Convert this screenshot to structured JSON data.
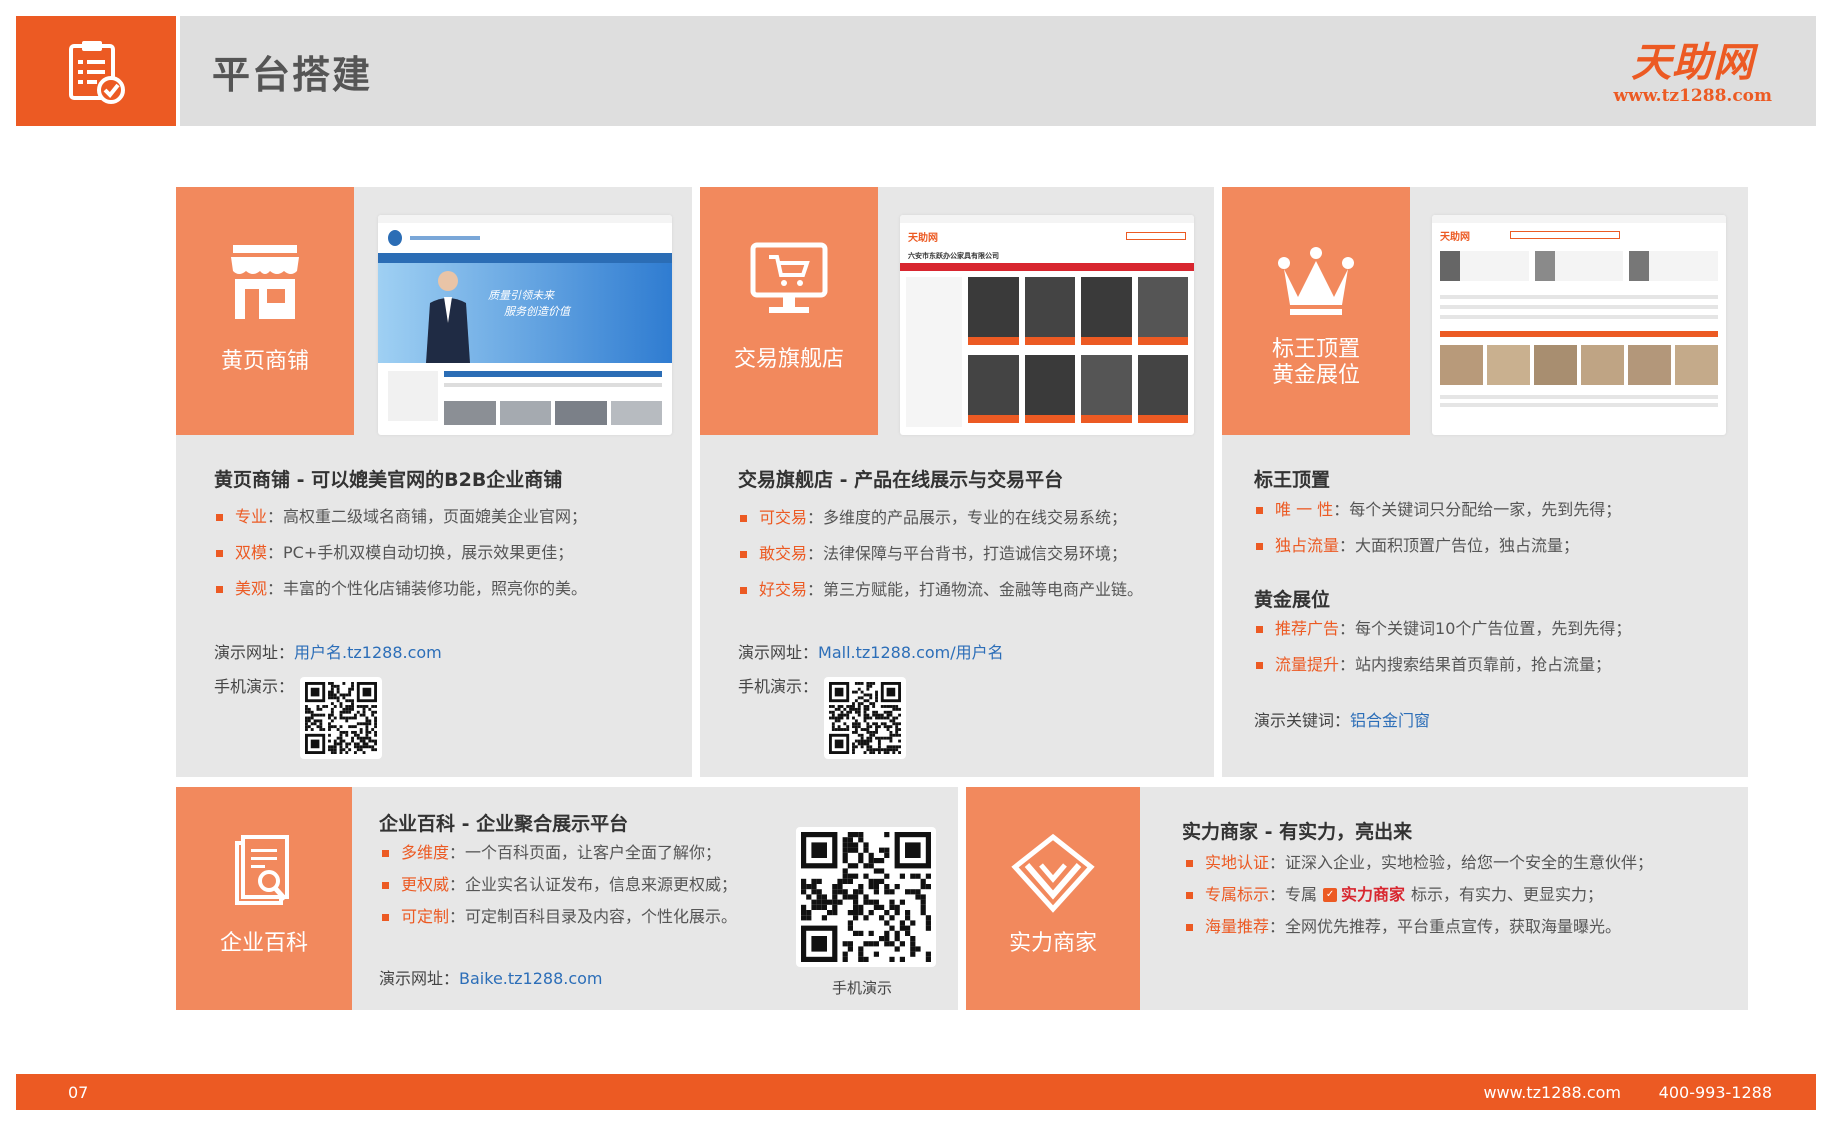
{
  "header": {
    "title": "平台搭建",
    "logo_text": "天助网",
    "logo_url": "www.tz1288.com",
    "accent": "#ec5a23"
  },
  "yellow_pages": {
    "tile_label": "黄页商铺",
    "title": "黄页商铺 - 可以媲美官网的B2B企业商铺",
    "items": [
      {
        "key": "专业",
        "text": "：高权重二级域名商铺，页面媲美企业官网；"
      },
      {
        "key": "双模",
        "text": "：PC+手机双模自动切换，展示效果更佳；"
      },
      {
        "key": "美观",
        "text": "：丰富的个性化店铺装修功能，照亮你的美。"
      }
    ],
    "demo_label": "演示网址：",
    "demo_link": "用户名.tz1288.com",
    "mobile_label": "手机演示：",
    "shot_banner_line1": "质量引领未来",
    "shot_banner_line2": "服务创造价值"
  },
  "flagship": {
    "tile_label": "交易旗舰店",
    "title": "交易旗舰店 - 产品在线展示与交易平台",
    "items": [
      {
        "key": "可交易",
        "text": "：多维度的产品展示，专业的在线交易系统；"
      },
      {
        "key": "敢交易",
        "text": "：法律保障与平台背书，打造诚信交易环境；"
      },
      {
        "key": "好交易",
        "text": "：第三方赋能，打通物流、金融等电商产业链。"
      }
    ],
    "demo_label": "演示网址：",
    "demo_link": "Mall.tz1288.com/用户名",
    "mobile_label": "手机演示：",
    "shot_company": "六安市东跃办公家具有限公司",
    "shot_logo": "天助网"
  },
  "top_ads": {
    "tile_label_1": "标王顶置",
    "tile_label_2": "黄金展位",
    "section1_title": "标王顶置",
    "section1_items": [
      {
        "key": "唯 一 性",
        "text": "：每个关键词只分配给一家，先到先得；"
      },
      {
        "key": "独占流量",
        "text": "：大面积顶置广告位，独占流量；"
      }
    ],
    "section2_title": "黄金展位",
    "section2_items": [
      {
        "key": "推荐广告",
        "text": "：每个关键词10个广告位置，先到先得；"
      },
      {
        "key": "流量提升",
        "text": "：站内搜索结果首页靠前，抢占流量；"
      }
    ],
    "demo_label": "演示关键词：",
    "demo_link": "铝合金门窗",
    "shot_logo": "天助网"
  },
  "baike": {
    "tile_label": "企业百科",
    "title": "企业百科 - 企业聚合展示平台",
    "items": [
      {
        "key": "多维度",
        "text": "：一个百科页面，让客户全面了解你；"
      },
      {
        "key": "更权威",
        "text": "：企业实名认证发布，信息来源更权威；"
      },
      {
        "key": "可定制",
        "text": "：可定制百科目录及内容，个性化展示。"
      }
    ],
    "demo_label": "演示网址：",
    "demo_link": "Baike.tz1288.com",
    "qr_caption": "手机演示"
  },
  "strong_merchant": {
    "tile_label": "实力商家",
    "title": "实力商家 - 有实力，亮出来",
    "items": [
      {
        "key": "实地认证",
        "text": "：证深入企业，实地检验，给您一个安全的生意伙伴；"
      },
      {
        "key": "专属标示",
        "text": "：专属",
        "badge": "实力商家",
        "after": "标示，有实力、更显实力；"
      },
      {
        "key": "海量推荐",
        "text": "：全网优先推荐，平台重点宣传，获取海量曝光。"
      }
    ]
  },
  "footer": {
    "page_number": "07",
    "website": "www.tz1288.com",
    "phone": "400-993-1288"
  }
}
